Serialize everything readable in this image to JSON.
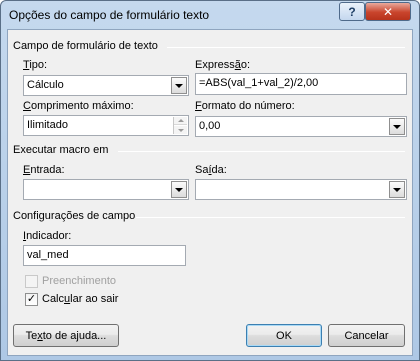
{
  "window": {
    "title": "Opções do campo de formulário texto",
    "help_icon": "question-mark",
    "close_icon": "x"
  },
  "text_form_field": {
    "group_title": "Campo de formulário de texto",
    "type": {
      "label_mnemonic": "T",
      "label_rest": "ipo:",
      "value": "Cálculo"
    },
    "expression": {
      "label_start": "Express",
      "label_mnemonic": "ã",
      "label_end": "o:",
      "value": "=ABS(val_1+val_2)/2,00"
    },
    "max_length": {
      "label_mnemonic": "C",
      "label_rest": "omprimento máximo:",
      "value": "Ilimitado"
    },
    "number_format": {
      "label_mnemonic": "F",
      "label_rest": "ormato do número:",
      "value": "0,00"
    }
  },
  "run_macro": {
    "group_title": "Executar macro em",
    "entry": {
      "label_mnemonic": "E",
      "label_rest": "ntrada:",
      "value": ""
    },
    "exit": {
      "label_start": "Sa",
      "label_mnemonic": "í",
      "label_end": "da:",
      "value": ""
    }
  },
  "field_settings": {
    "group_title": "Configurações de campo",
    "bookmark": {
      "label_mnemonic": "I",
      "label_rest": "ndicador:",
      "value": "val_med"
    },
    "fill_in": {
      "label": "Preenchimento",
      "checked": false,
      "disabled": true
    },
    "calc_on_exit": {
      "label_start": "Calc",
      "label_mnemonic": "u",
      "label_end": "lar ao sair",
      "checked": true,
      "check_glyph": "✓"
    }
  },
  "buttons": {
    "help_text": {
      "label_start": "Te",
      "label_mnemonic": "x",
      "label_end": "to de ajuda..."
    },
    "ok": "OK",
    "cancel": "Cancelar"
  }
}
